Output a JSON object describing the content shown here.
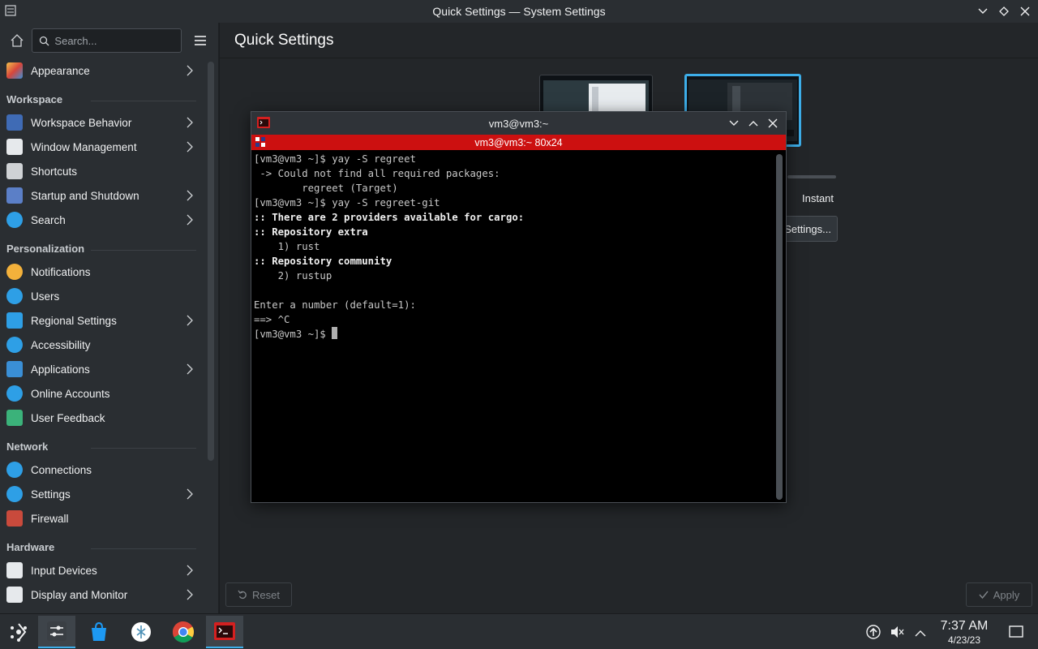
{
  "window": {
    "title": "Quick Settings — System Settings"
  },
  "sidebar": {
    "search_placeholder": "Search...",
    "items": [
      {
        "label": "Appearance",
        "icon": "appearance-icon",
        "chevron": true
      },
      {
        "header": "Workspace"
      },
      {
        "label": "Workspace Behavior",
        "icon": "workspace-behavior-icon",
        "chevron": true
      },
      {
        "label": "Window Management",
        "icon": "window-management-icon",
        "chevron": true
      },
      {
        "label": "Shortcuts",
        "icon": "keyboard-icon",
        "chevron": false
      },
      {
        "label": "Startup and Shutdown",
        "icon": "startup-icon",
        "chevron": true
      },
      {
        "label": "Search",
        "icon": "search-icon",
        "chevron": true
      },
      {
        "header": "Personalization"
      },
      {
        "label": "Notifications",
        "icon": "bell-icon",
        "chevron": false
      },
      {
        "label": "Users",
        "icon": "users-icon",
        "chevron": false
      },
      {
        "label": "Regional Settings",
        "icon": "regional-icon",
        "chevron": true
      },
      {
        "label": "Accessibility",
        "icon": "accessibility-icon",
        "chevron": false
      },
      {
        "label": "Applications",
        "icon": "applications-icon",
        "chevron": true
      },
      {
        "label": "Online Accounts",
        "icon": "online-accounts-icon",
        "chevron": false
      },
      {
        "label": "User Feedback",
        "icon": "feedback-icon",
        "chevron": false
      },
      {
        "header": "Network"
      },
      {
        "label": "Connections",
        "icon": "globe-icon",
        "chevron": false
      },
      {
        "label": "Settings",
        "icon": "globe-settings-icon",
        "chevron": true
      },
      {
        "label": "Firewall",
        "icon": "firewall-icon",
        "chevron": false
      },
      {
        "header": "Hardware"
      },
      {
        "label": "Input Devices",
        "icon": "mouse-icon",
        "chevron": true
      },
      {
        "label": "Display and Monitor",
        "icon": "monitor-icon",
        "chevron": true
      }
    ]
  },
  "main": {
    "title": "Quick Settings",
    "instant_label": "Instant",
    "settings_button": "Settings...",
    "reset_button": "Reset",
    "apply_button": "Apply"
  },
  "terminal": {
    "title": "vm3@vm3:~",
    "tab_title": "vm3@vm3:~ 80x24",
    "lines": [
      {
        "text": "[vm3@vm3 ~]$ yay -S regreet",
        "bold": false
      },
      {
        "text": " -> Could not find all required packages:",
        "bold": false
      },
      {
        "text": "        regreet (Target)",
        "bold": false
      },
      {
        "text": "[vm3@vm3 ~]$ yay -S regreet-git",
        "bold": false
      },
      {
        "text": ":: There are 2 providers available for cargo:",
        "bold": true
      },
      {
        "text": ":: Repository extra",
        "bold": true
      },
      {
        "text": "    1) rust",
        "bold": false
      },
      {
        "text": ":: Repository community",
        "bold": true
      },
      {
        "text": "    2) rustup",
        "bold": false
      },
      {
        "text": "",
        "bold": false
      },
      {
        "text": "Enter a number (default=1):",
        "bold": false
      },
      {
        "text": "==> ^C",
        "bold": false
      }
    ],
    "prompt": "[vm3@vm3 ~]$ "
  },
  "taskbar": {
    "time": "7:37 AM",
    "date": "4/23/23"
  },
  "colors": {
    "accent": "#3daee9",
    "terminal_tab": "#cc1010",
    "window_bg": "#232629"
  }
}
